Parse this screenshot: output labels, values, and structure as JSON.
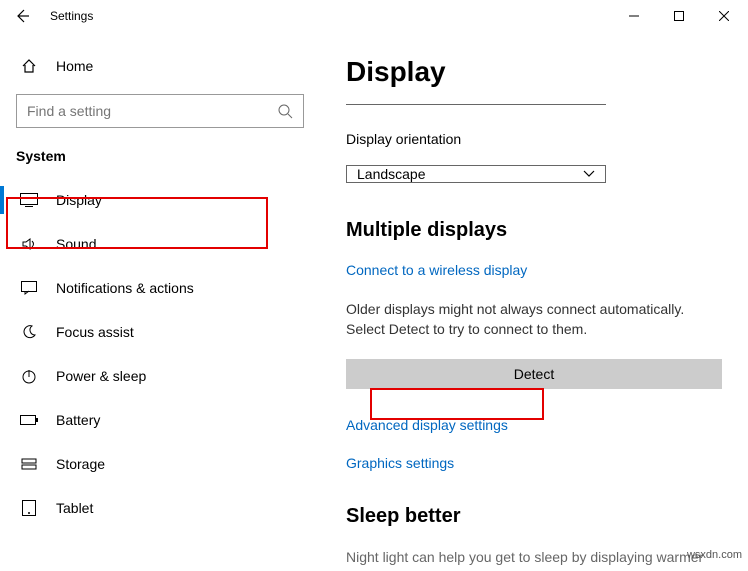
{
  "titlebar": {
    "app_title": "Settings"
  },
  "sidebar": {
    "home_label": "Home",
    "search_placeholder": "Find a setting",
    "category": "System",
    "items": [
      {
        "label": "Display",
        "icon": "monitor-icon",
        "active": true
      },
      {
        "label": "Sound",
        "icon": "speaker-icon"
      },
      {
        "label": "Notifications & actions",
        "icon": "message-icon"
      },
      {
        "label": "Focus assist",
        "icon": "moon-icon"
      },
      {
        "label": "Power & sleep",
        "icon": "power-icon"
      },
      {
        "label": "Battery",
        "icon": "battery-icon"
      },
      {
        "label": "Storage",
        "icon": "storage-icon"
      },
      {
        "label": "Tablet",
        "icon": "tablet-icon"
      }
    ]
  },
  "main": {
    "page_title": "Display",
    "orientation_label": "Display orientation",
    "orientation_value": "Landscape",
    "multiple_displays_heading": "Multiple displays",
    "connect_wireless_link": "Connect to a wireless display",
    "detect_desc": "Older displays might not always connect automatically. Select Detect to try to connect to them.",
    "detect_button": "Detect",
    "advanced_link": "Advanced display settings",
    "graphics_link": "Graphics settings",
    "sleep_better_heading": "Sleep better",
    "sleep_better_desc": "Night light can help you get to sleep by displaying warmer"
  },
  "watermark": "wsxdn.com"
}
